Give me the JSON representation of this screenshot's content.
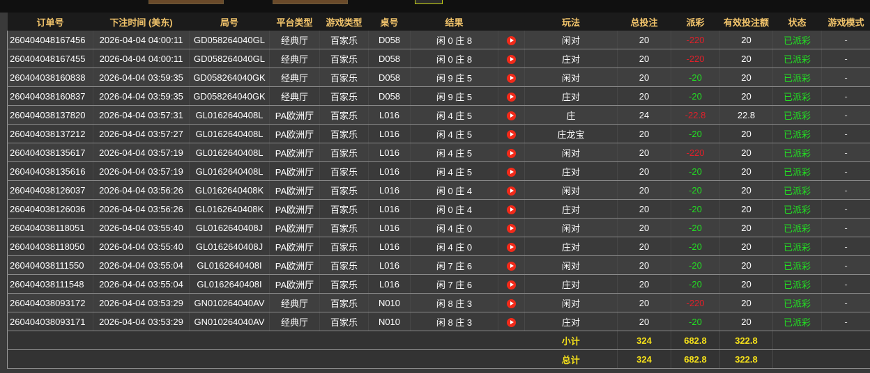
{
  "header": {
    "columns": [
      "订单号",
      "下注时间 (美东)",
      "局号",
      "平台类型",
      "游戏类型",
      "桌号",
      "结果",
      "",
      "玩法",
      "总投注",
      "派彩",
      "有效投注额",
      "状态",
      "游戏模式"
    ]
  },
  "rows": [
    {
      "order": "260404048167456",
      "time": "2026-04-04 04:00:11",
      "round": "GD058264040GL",
      "platform": "经典厅",
      "game": "百家乐",
      "table": "D058",
      "result": "闲 0 庄 8",
      "play": "闲对",
      "bet": "20",
      "payout": "-220",
      "payout_type": "pos",
      "valid": "20",
      "status": "已派彩",
      "mode": "-"
    },
    {
      "order": "260404048167455",
      "time": "2026-04-04 04:00:11",
      "round": "GD058264040GL",
      "platform": "经典厅",
      "game": "百家乐",
      "table": "D058",
      "result": "闲 0 庄 8",
      "play": "庄对",
      "bet": "20",
      "payout": "-220",
      "payout_type": "pos",
      "valid": "20",
      "status": "已派彩",
      "mode": "-"
    },
    {
      "order": "260404038160838",
      "time": "2026-04-04 03:59:35",
      "round": "GD058264040GK",
      "platform": "经典厅",
      "game": "百家乐",
      "table": "D058",
      "result": "闲 9 庄 5",
      "play": "闲对",
      "bet": "20",
      "payout": "-20",
      "payout_type": "neg",
      "valid": "20",
      "status": "已派彩",
      "mode": "-"
    },
    {
      "order": "260404038160837",
      "time": "2026-04-04 03:59:35",
      "round": "GD058264040GK",
      "platform": "经典厅",
      "game": "百家乐",
      "table": "D058",
      "result": "闲 9 庄 5",
      "play": "庄对",
      "bet": "20",
      "payout": "-20",
      "payout_type": "neg",
      "valid": "20",
      "status": "已派彩",
      "mode": "-"
    },
    {
      "order": "260404038137820",
      "time": "2026-04-04 03:57:31",
      "round": "GL0162640408L",
      "platform": "PA欧洲厅",
      "game": "百家乐",
      "table": "L016",
      "result": "闲 4 庄 5",
      "play": "庄",
      "bet": "24",
      "payout": "-22.8",
      "payout_type": "pos",
      "valid": "22.8",
      "status": "已派彩",
      "mode": "-"
    },
    {
      "order": "260404038137212",
      "time": "2026-04-04 03:57:27",
      "round": "GL0162640408L",
      "platform": "PA欧洲厅",
      "game": "百家乐",
      "table": "L016",
      "result": "闲 4 庄 5",
      "play": "庄龙宝",
      "bet": "20",
      "payout": "-20",
      "payout_type": "neg",
      "valid": "20",
      "status": "已派彩",
      "mode": "-"
    },
    {
      "order": "260404038135617",
      "time": "2026-04-04 03:57:19",
      "round": "GL0162640408L",
      "platform": "PA欧洲厅",
      "game": "百家乐",
      "table": "L016",
      "result": "闲 4 庄 5",
      "play": "闲对",
      "bet": "20",
      "payout": "-220",
      "payout_type": "pos",
      "valid": "20",
      "status": "已派彩",
      "mode": "-"
    },
    {
      "order": "260404038135616",
      "time": "2026-04-04 03:57:19",
      "round": "GL0162640408L",
      "platform": "PA欧洲厅",
      "game": "百家乐",
      "table": "L016",
      "result": "闲 4 庄 5",
      "play": "庄对",
      "bet": "20",
      "payout": "-20",
      "payout_type": "neg",
      "valid": "20",
      "status": "已派彩",
      "mode": "-"
    },
    {
      "order": "260404038126037",
      "time": "2026-04-04 03:56:26",
      "round": "GL0162640408K",
      "platform": "PA欧洲厅",
      "game": "百家乐",
      "table": "L016",
      "result": "闲 0 庄 4",
      "play": "闲对",
      "bet": "20",
      "payout": "-20",
      "payout_type": "neg",
      "valid": "20",
      "status": "已派彩",
      "mode": "-"
    },
    {
      "order": "260404038126036",
      "time": "2026-04-04 03:56:26",
      "round": "GL0162640408K",
      "platform": "PA欧洲厅",
      "game": "百家乐",
      "table": "L016",
      "result": "闲 0 庄 4",
      "play": "庄对",
      "bet": "20",
      "payout": "-20",
      "payout_type": "neg",
      "valid": "20",
      "status": "已派彩",
      "mode": "-"
    },
    {
      "order": "260404038118051",
      "time": "2026-04-04 03:55:40",
      "round": "GL0162640408J",
      "platform": "PA欧洲厅",
      "game": "百家乐",
      "table": "L016",
      "result": "闲 4 庄 0",
      "play": "闲对",
      "bet": "20",
      "payout": "-20",
      "payout_type": "neg",
      "valid": "20",
      "status": "已派彩",
      "mode": "-"
    },
    {
      "order": "260404038118050",
      "time": "2026-04-04 03:55:40",
      "round": "GL0162640408J",
      "platform": "PA欧洲厅",
      "game": "百家乐",
      "table": "L016",
      "result": "闲 4 庄 0",
      "play": "庄对",
      "bet": "20",
      "payout": "-20",
      "payout_type": "neg",
      "valid": "20",
      "status": "已派彩",
      "mode": "-"
    },
    {
      "order": "260404038111550",
      "time": "2026-04-04 03:55:04",
      "round": "GL0162640408I",
      "platform": "PA欧洲厅",
      "game": "百家乐",
      "table": "L016",
      "result": "闲 7 庄 6",
      "play": "闲对",
      "bet": "20",
      "payout": "-20",
      "payout_type": "neg",
      "valid": "20",
      "status": "已派彩",
      "mode": "-"
    },
    {
      "order": "260404038111548",
      "time": "2026-04-04 03:55:04",
      "round": "GL0162640408I",
      "platform": "PA欧洲厅",
      "game": "百家乐",
      "table": "L016",
      "result": "闲 7 庄 6",
      "play": "庄对",
      "bet": "20",
      "payout": "-20",
      "payout_type": "neg",
      "valid": "20",
      "status": "已派彩",
      "mode": "-"
    },
    {
      "order": "260404038093172",
      "time": "2026-04-04 03:53:29",
      "round": "GN010264040AV",
      "platform": "经典厅",
      "game": "百家乐",
      "table": "N010",
      "result": "闲 8 庄 3",
      "play": "闲对",
      "bet": "20",
      "payout": "-220",
      "payout_type": "pos",
      "valid": "20",
      "status": "已派彩",
      "mode": "-"
    },
    {
      "order": "260404038093171",
      "time": "2026-04-04 03:53:29",
      "round": "GN010264040AV",
      "platform": "经典厅",
      "game": "百家乐",
      "table": "N010",
      "result": "闲 8 庄 3",
      "play": "庄对",
      "bet": "20",
      "payout": "-20",
      "payout_type": "neg",
      "valid": "20",
      "status": "已派彩",
      "mode": "-"
    }
  ],
  "subtotal": {
    "label": "小计",
    "bet": "324",
    "payout": "682.8",
    "valid": "322.8"
  },
  "total": {
    "label": "总计",
    "bet": "324",
    "payout": "682.8",
    "valid": "322.8"
  },
  "colors": {
    "header_text": "#f2c46b",
    "loss": "#22e022",
    "win": "#e0202a",
    "summary": "#f5e01a",
    "replay_icon": "#f22a1a"
  },
  "icons": {
    "replay": "play-circle-icon"
  }
}
